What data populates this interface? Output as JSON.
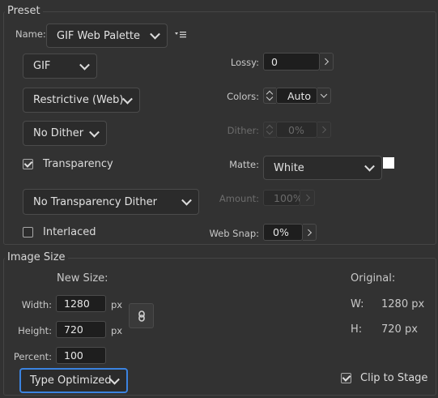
{
  "preset": {
    "section_title": "Preset",
    "name_label": "Name:",
    "name_value": "GIF Web Palette",
    "format": "GIF",
    "palette": "Restrictive (Web)",
    "dither_algorithm": "No Dither",
    "transparency_label": "Transparency",
    "transparency_checked": true,
    "transparency_dither": "No Transparency Dither",
    "interlaced_label": "Interlaced",
    "interlaced_checked": false,
    "lossy_label": "Lossy:",
    "lossy_value": "0",
    "colors_label": "Colors:",
    "colors_value": "Auto",
    "dither_label": "Dither:",
    "dither_value": "0%",
    "matte_label": "Matte:",
    "matte_value": "White",
    "matte_swatch_color": "#ffffff",
    "amount_label": "Amount:",
    "amount_value": "100%",
    "websnap_label": "Web Snap:",
    "websnap_value": "0%"
  },
  "image_size": {
    "section_title": "Image Size",
    "new_size_label": "New Size:",
    "width_label": "Width:",
    "width_value": "1280",
    "height_label": "Height:",
    "height_value": "720",
    "percent_label": "Percent:",
    "percent_value": "100",
    "unit": "px",
    "resample": "Type Optimized",
    "original_label": "Original:",
    "orig_w_label": "W:",
    "orig_w_value": "1280 px",
    "orig_h_label": "H:",
    "orig_h_value": "720 px",
    "clip_label": "Clip to Stage",
    "clip_checked": true
  },
  "colors": {
    "accent": "#3b83e0"
  }
}
